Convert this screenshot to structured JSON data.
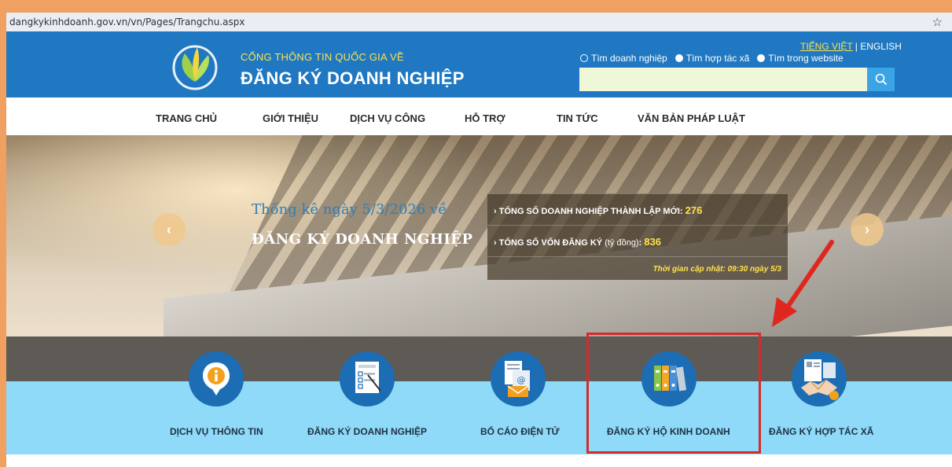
{
  "browser": {
    "url": "dangkykinhdoanh.gov.vn/vn/Pages/Trangchu.aspx"
  },
  "header": {
    "line1": "CỔNG THÔNG TIN QUỐC GIA VỀ",
    "line2": "ĐĂNG KÝ DOANH NGHIỆP",
    "lang_vi": "TIẾNG VIỆT",
    "lang_sep": " | ",
    "lang_en": "ENGLISH",
    "search_options": [
      "Tìm doanh nghiệp",
      "Tìm hợp tác xã",
      "Tìm trong website"
    ],
    "search_value": ""
  },
  "nav": {
    "items": [
      "TRANG CHỦ",
      "GIỚI THIỆU",
      "DỊCH VỤ CÔNG",
      "HỖ TRỢ",
      "TIN TỨC",
      "VĂN BẢN PHÁP LUẬT"
    ]
  },
  "hero": {
    "title1": "Thống kê ngày 5/3/2026 về",
    "title2": "ĐĂNG KÝ DOANH NGHIỆP",
    "stat1_label": "› TỔNG SỐ DOANH NGHIỆP THÀNH LẬP MỚI: ",
    "stat1_value": "276",
    "stat2_label": "› TỔNG SỐ VỐN ĐĂNG KÝ ",
    "stat2_unit": "(tỷ đồng)",
    "stat2_colon": ": ",
    "stat2_value": "836",
    "updated": "Thời gian cập nhật: 09:30 ngày 5/3"
  },
  "services": [
    {
      "label": "DỊCH VỤ THÔNG TIN",
      "icon": "info-icon"
    },
    {
      "label": "ĐĂNG KÝ DOANH NGHIỆP",
      "icon": "form-icon"
    },
    {
      "label": "BỐ CÁO ĐIỆN TỬ",
      "icon": "email-document-icon"
    },
    {
      "label": "ĐĂNG KÝ HỘ KINH DOANH",
      "icon": "binders-icon"
    },
    {
      "label": "ĐĂNG KÝ HỢP TÁC XÃ",
      "icon": "handshake-icon"
    }
  ],
  "colors": {
    "header_blue": "#1f78c1",
    "accent_yellow": "#ffe24a",
    "highlight_red": "#d42b2b",
    "service_band": "#8fdaf9"
  }
}
